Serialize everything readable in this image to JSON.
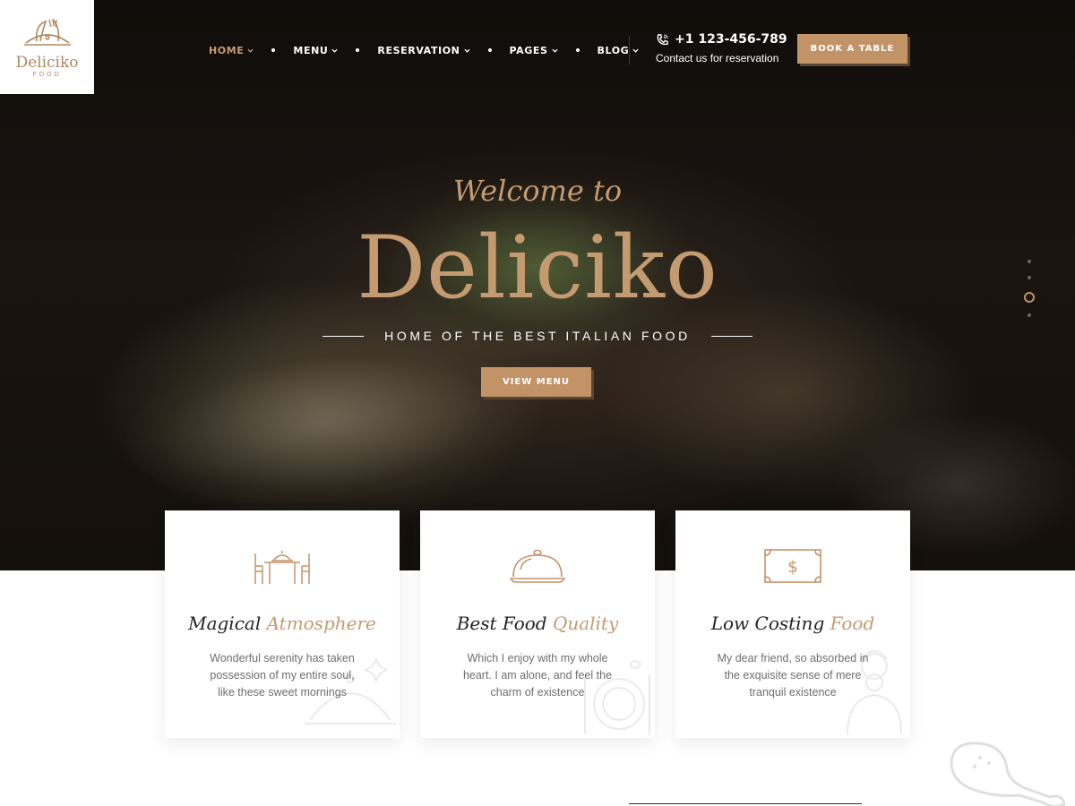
{
  "brand": {
    "logo_name": "Deliciko",
    "logo_sub": "FOOD"
  },
  "nav": {
    "items": [
      {
        "label": "HOME",
        "active": true
      },
      {
        "label": "MENU",
        "active": false
      },
      {
        "label": "RESERVATION",
        "active": false
      },
      {
        "label": "PAGES",
        "active": false
      },
      {
        "label": "BLOG",
        "active": false
      }
    ]
  },
  "contact": {
    "phone": "+1 123-456-789",
    "subtitle": "Contact us for reservation"
  },
  "book_button": "BOOK A TABLE",
  "hero": {
    "welcome": "Welcome to",
    "title": "Deliciko",
    "tagline": "HOME OF THE BEST ITALIAN FOOD",
    "cta": "VIEW MENU",
    "slides": 4,
    "active_slide": 3
  },
  "features": [
    {
      "title_plain": "Magical ",
      "title_accent": "Atmosphere",
      "text": "Wonderful serenity has taken possession of my entire soul, like these sweet mornings",
      "icon": "dining-table-icon"
    },
    {
      "title_plain": "Best Food ",
      "title_accent": "Quality",
      "text": "Which I enjoy with my whole heart. I am alone, and feel the charm of existence",
      "icon": "cloche-icon"
    },
    {
      "title_plain": "Low Costing ",
      "title_accent": "Food",
      "text": "My dear friend, so absorbed in the exquisite sense of mere tranquil existence",
      "icon": "dollar-bill-icon"
    }
  ],
  "colors": {
    "accent": "#c39368",
    "accent_text": "#c49a70",
    "dark_bg": "#14100c",
    "text_muted": "#6e6e6e"
  }
}
